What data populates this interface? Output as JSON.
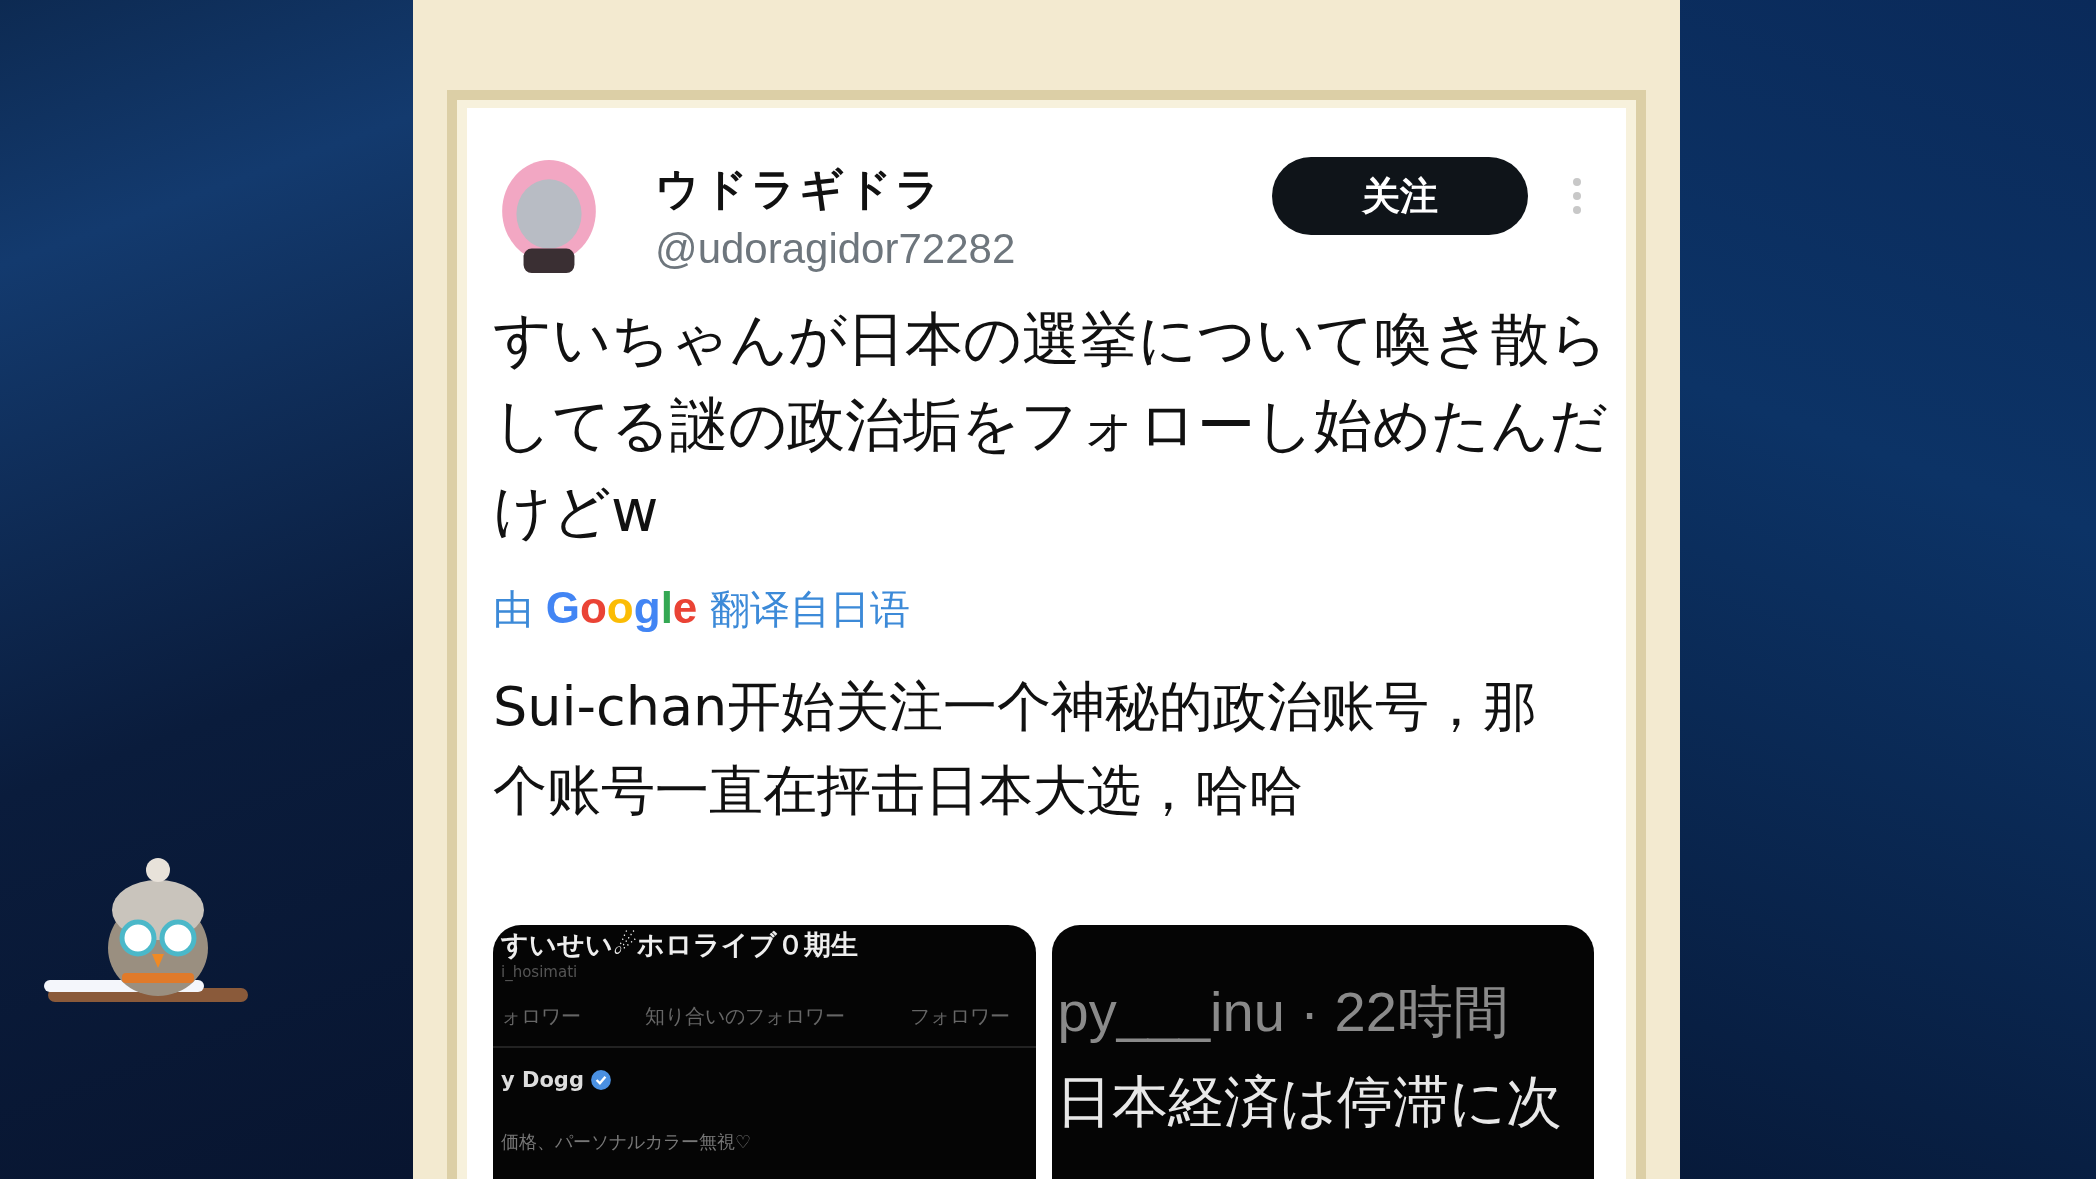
{
  "tweet": {
    "author": {
      "name": "ウドラギドラ",
      "handle": "@udoragidor72282"
    },
    "follow_button": "关注",
    "text": "すいちゃんが日本の選挙について喚き散らしてる謎の政治垢をフォローし始めたんだけどw",
    "translation_note": [
      {
        "text": "由 ",
        "kind": "plain"
      },
      {
        "text": "Google",
        "kind": "brand"
      },
      {
        "text": " 翻译自日语",
        "kind": "plain"
      }
    ],
    "translation": "Sui-chan开始关注一个神秘的政治账号，那个账号一直在抨击日本大选，哈哈",
    "images": [
      {
        "kind": "profile",
        "title": "すいせい☄ホロライブ０期生",
        "handle": "i_hosimati",
        "tabs": [
          "ォロワー",
          "知り合いのフォロワー",
          "フォロワー"
        ],
        "user": "y Dogg",
        "bio": "価格、パーソナルカラー無視♡"
      },
      {
        "kind": "post",
        "meta": "py___inu · 22時間",
        "body": "日本経済は停滞に次"
      }
    ]
  }
}
